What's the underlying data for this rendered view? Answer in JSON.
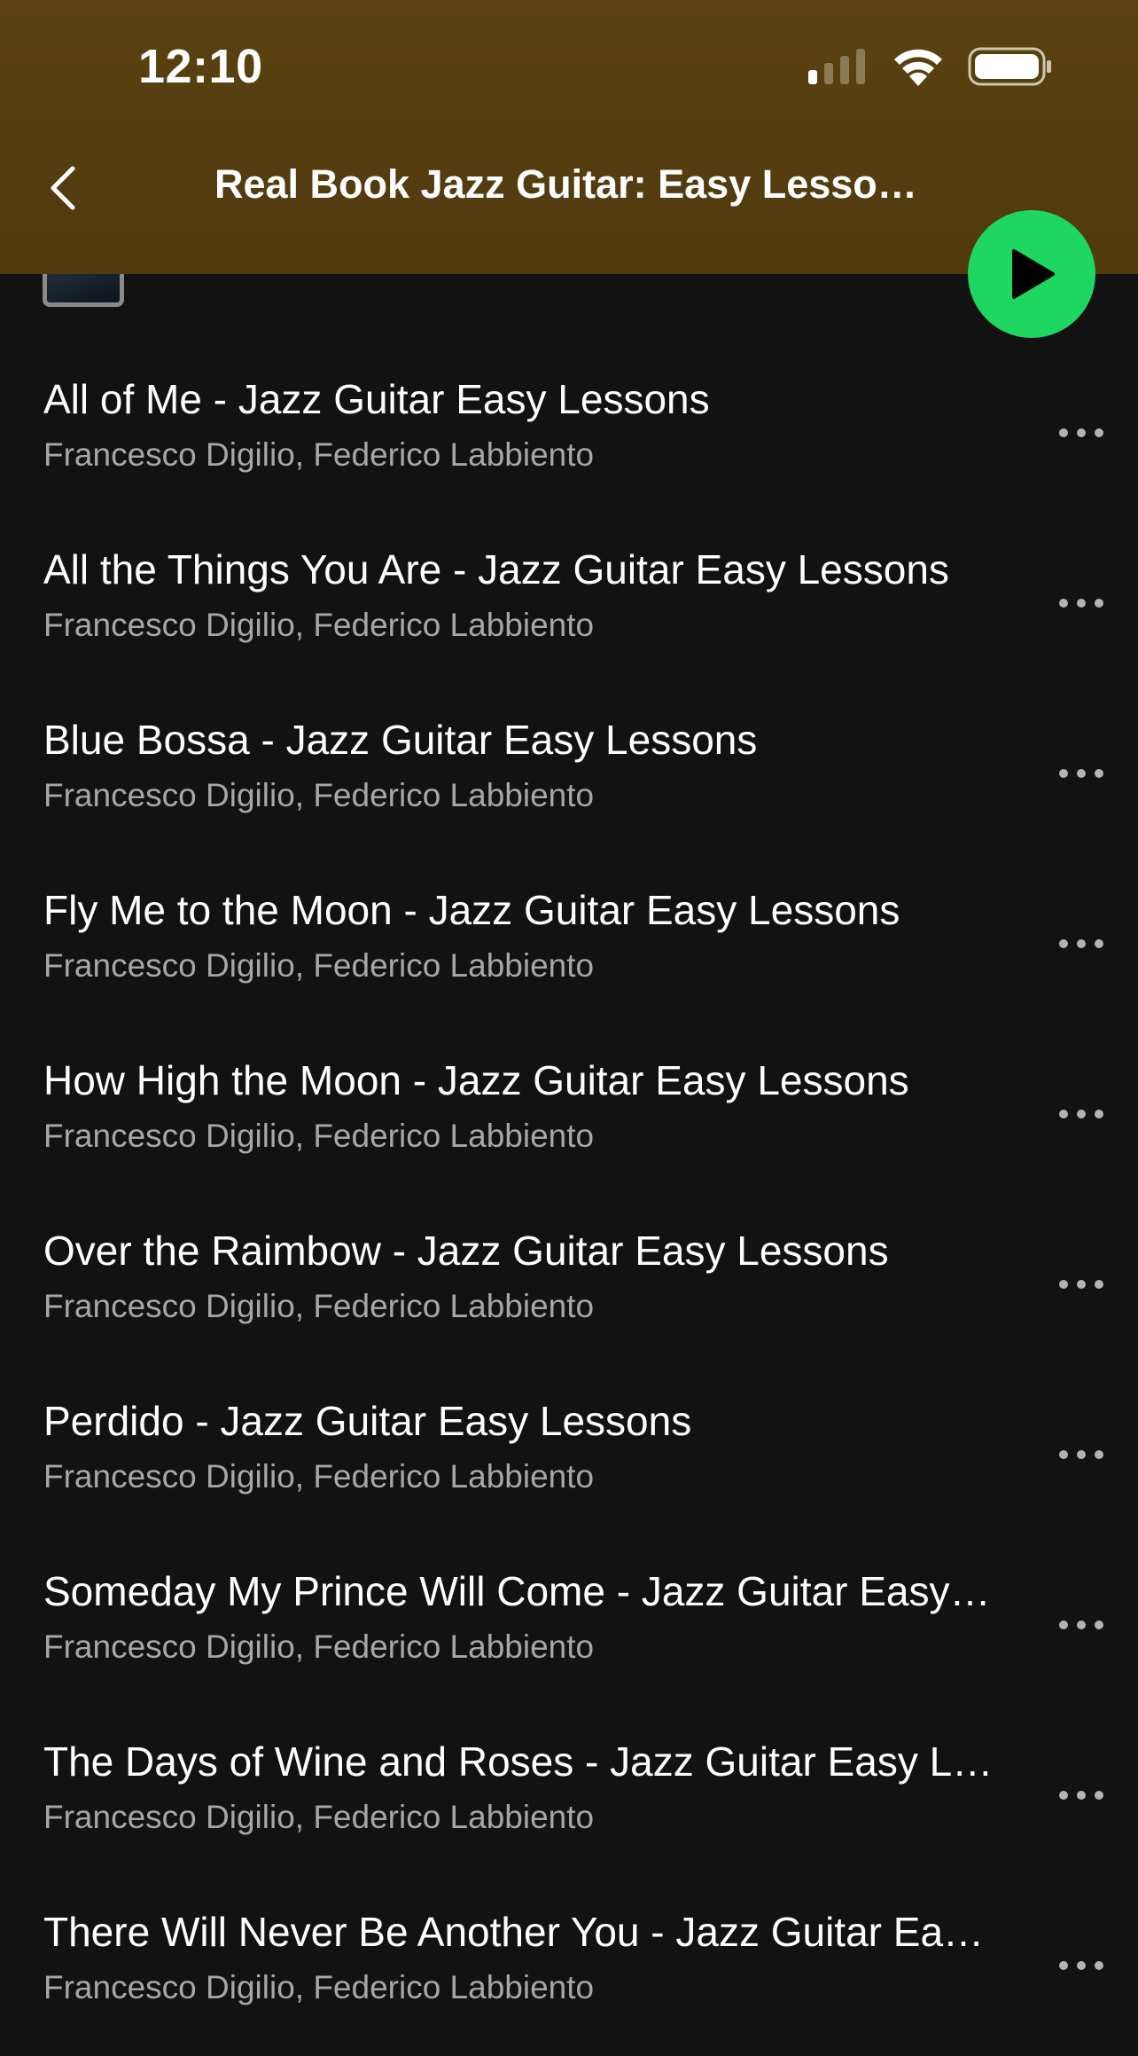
{
  "status_bar": {
    "time": "12:10",
    "signal_icon": "cellular-signal-icon",
    "wifi_icon": "wifi-icon",
    "battery_icon": "battery-icon"
  },
  "header": {
    "back_icon": "chevron-left-icon",
    "title": "Real Book Jazz Guitar: Easy Lesson…"
  },
  "play_button": {
    "icon": "play-icon",
    "color": "#1ed760"
  },
  "colors": {
    "header_bg": "#5a4211",
    "page_bg": "#121212",
    "accent": "#1ed760",
    "secondary_text": "#a7a7a7"
  },
  "tracks": [
    {
      "title": "All of Me - Jazz Guitar Easy Lessons",
      "artist": "Francesco Digilio, Federico Labbiento"
    },
    {
      "title": "All the Things You Are - Jazz Guitar Easy Lessons",
      "artist": "Francesco Digilio, Federico Labbiento"
    },
    {
      "title": "Blue Bossa - Jazz Guitar Easy Lessons",
      "artist": "Francesco Digilio, Federico Labbiento"
    },
    {
      "title": "Fly Me to the Moon - Jazz Guitar Easy Lessons",
      "artist": "Francesco Digilio, Federico Labbiento"
    },
    {
      "title": "How High the Moon - Jazz Guitar Easy Lessons",
      "artist": "Francesco Digilio, Federico Labbiento"
    },
    {
      "title": "Over the Raimbow - Jazz Guitar Easy Lessons",
      "artist": "Francesco Digilio, Federico Labbiento"
    },
    {
      "title": "Perdido - Jazz Guitar Easy Lessons",
      "artist": "Francesco Digilio, Federico Labbiento"
    },
    {
      "title": "Someday My Prince Will Come - Jazz Guitar Easy…",
      "artist": "Francesco Digilio, Federico Labbiento"
    },
    {
      "title": "The Days of Wine and Roses - Jazz Guitar Easy Le…",
      "artist": "Francesco Digilio, Federico Labbiento"
    },
    {
      "title": "There Will Never Be Another You - Jazz Guitar Ea…",
      "artist": "Francesco Digilio, Federico Labbiento"
    }
  ]
}
